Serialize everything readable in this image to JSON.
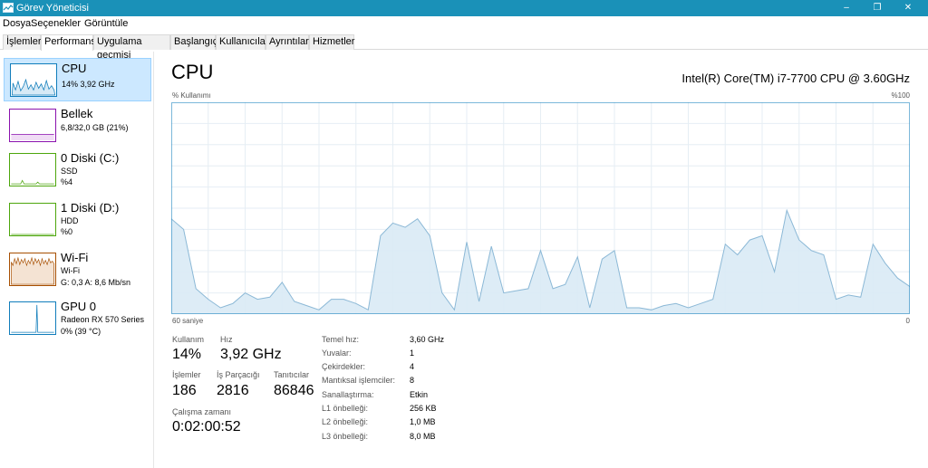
{
  "window": {
    "title": "Görev Yöneticisi",
    "minimize": "–",
    "maximize": "❐",
    "close": "✕"
  },
  "menu": {
    "file": "Dosya",
    "options": "Seçenekler",
    "view": "Görüntüle"
  },
  "tabs": [
    "İşlemler",
    "Performans",
    "Uygulama geçmişi",
    "Başlangıç",
    "Kullanıcılar",
    "Ayrıntılar",
    "Hizmetler"
  ],
  "sidebar": [
    {
      "name": "CPU",
      "line1": "14% 3,92 GHz",
      "line2": "",
      "color": "#117dbb"
    },
    {
      "name": "Bellek",
      "line1": "6,8/32,0 GB (21%)",
      "line2": "",
      "color": "#8b12ae"
    },
    {
      "name": "0 Diski (C:)",
      "line1": "SSD",
      "line2": "%4",
      "color": "#4da60c"
    },
    {
      "name": "1 Diski (D:)",
      "line1": "HDD",
      "line2": "%0",
      "color": "#4da60c"
    },
    {
      "name": "Wi-Fi",
      "line1": "Wi-Fi",
      "line2": "G: 0,3  A: 8,6 Mb/sn",
      "color": "#a74f01"
    },
    {
      "name": "GPU 0",
      "line1": "Radeon RX 570 Series",
      "line2": "0% (39 °C)",
      "color": "#117dbb"
    }
  ],
  "main": {
    "title": "CPU",
    "model": "Intel(R) Core(TM) i7-7700 CPU @ 3.60GHz",
    "graph_label_left": "% Kullanımı",
    "graph_label_right": "%100",
    "time_label_left": "60 saniye",
    "time_label_right": "0"
  },
  "chart_data": {
    "type": "area",
    "ylim": [
      0,
      100
    ],
    "color": "#117dbb",
    "values": [
      45,
      40,
      12,
      7,
      3,
      5,
      10,
      7,
      8,
      15,
      6,
      4,
      2,
      7,
      7,
      5,
      2,
      37,
      43,
      41,
      45,
      37,
      10,
      2,
      34,
      6,
      32,
      10,
      11,
      12,
      30,
      12,
      14,
      27,
      3,
      26,
      30,
      3,
      3,
      2,
      4,
      5,
      3,
      5,
      7,
      33,
      28,
      35,
      37,
      20,
      49,
      35,
      30,
      28,
      7,
      9,
      8,
      33,
      24,
      17,
      13
    ]
  },
  "stats": {
    "usage_label": "Kullanım",
    "usage_value": "14%",
    "speed_label": "Hız",
    "speed_value": "3,92 GHz",
    "processes_label": "İşlemler",
    "processes_value": "186",
    "threads_label": "İş Parçacığı",
    "threads_value": "2816",
    "handles_label": "Tanıtıcılar",
    "handles_value": "86846",
    "uptime_label": "Çalışma zamanı",
    "uptime_value": "0:02:00:52"
  },
  "specs": [
    {
      "label": "Temel hız:",
      "value": "3,60 GHz"
    },
    {
      "label": "Yuvalar:",
      "value": "1"
    },
    {
      "label": "Çekirdekler:",
      "value": "4"
    },
    {
      "label": "Mantıksal işlemciler:",
      "value": "8"
    },
    {
      "label": "Sanallaştırma:",
      "value": "Etkin"
    },
    {
      "label": "L1 önbelleği:",
      "value": "256 KB"
    },
    {
      "label": "L2 önbelleği:",
      "value": "1,0 MB"
    },
    {
      "label": "L3 önbelleği:",
      "value": "8,0 MB"
    }
  ]
}
